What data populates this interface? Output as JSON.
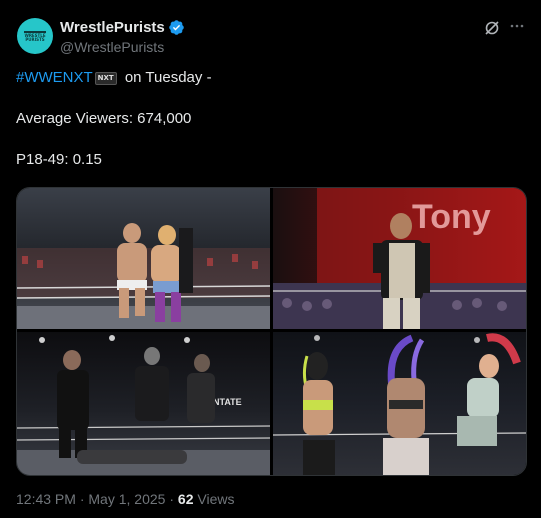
{
  "author": {
    "display_name": "WrestlePurists",
    "handle": "@WrestlePurists",
    "avatar_text_top": "WRESTLE",
    "avatar_text_bottom": "PURISTS",
    "avatar_color": "#26c6c9",
    "verified_color": "#1d9bf0"
  },
  "tweet": {
    "hashtag": "#WWENXT",
    "hashtag_emoji_text": "NXT",
    "line1_rest": " on Tuesday -",
    "line2": "Average Viewers: 674,000",
    "line3": "P18-49: 0.15"
  },
  "media": {
    "images": [
      {
        "description_name": "photo-ring-grapple"
      },
      {
        "description_name": "photo-entrance-microphone",
        "sign_text": "Tony"
      },
      {
        "description_name": "photo-ring-brawl",
        "banner_text": "ENTATE"
      },
      {
        "description_name": "photo-womens-match"
      }
    ]
  },
  "meta": {
    "time": "12:43 PM",
    "separator": " · ",
    "date": "May 1, 2025",
    "views_count": "62",
    "views_label": " Views"
  },
  "colors": {
    "background": "#000000",
    "text": "#e7e9ea",
    "muted": "#71767b",
    "link": "#1d9bf0",
    "border": "#2f3336"
  }
}
